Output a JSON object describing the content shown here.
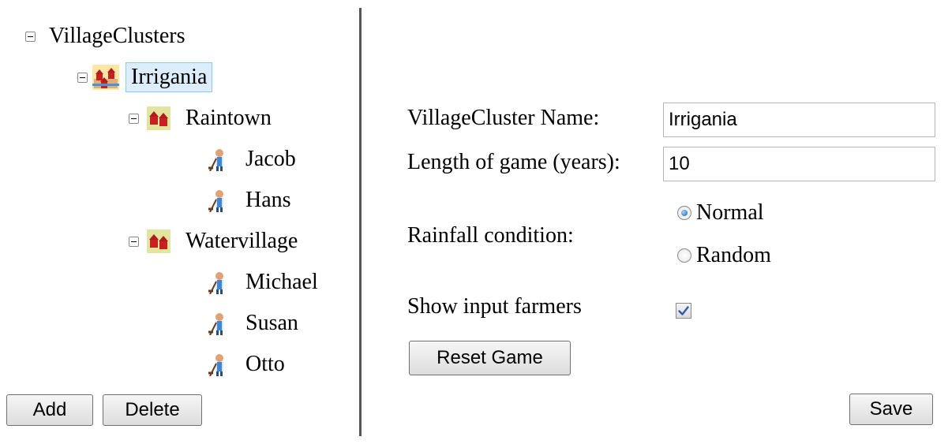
{
  "tree": {
    "root": {
      "label": "VillageClusters"
    },
    "cluster": {
      "label": "Irrigania"
    },
    "villages": [
      {
        "label": "Raintown",
        "farmers": [
          "Jacob",
          "Hans"
        ]
      },
      {
        "label": "Watervillage",
        "farmers": [
          "Michael",
          "Susan",
          "Otto"
        ]
      }
    ]
  },
  "icons": {
    "cluster": "village-cluster-icon",
    "village": "village-icon",
    "farmer": "farmer-icon",
    "toggle": "collapse-icon"
  },
  "left_buttons": {
    "add": "Add",
    "delete": "Delete"
  },
  "form": {
    "name_label": "VillageCluster Name:",
    "name_value": "Irrigania",
    "length_label": "Length of game (years):",
    "length_value": "10",
    "rainfall_label": "Rainfall condition:",
    "rainfall_options": [
      "Normal",
      "Random"
    ],
    "rainfall_selected": "Normal",
    "show_farmers_label": "Show input farmers",
    "show_farmers_checked": true,
    "reset_label": "Reset Game"
  },
  "save_label": "Save",
  "colors": {
    "selection_bg": "#dceefc",
    "selection_border": "#8ecbf2",
    "divider": "#555555"
  }
}
